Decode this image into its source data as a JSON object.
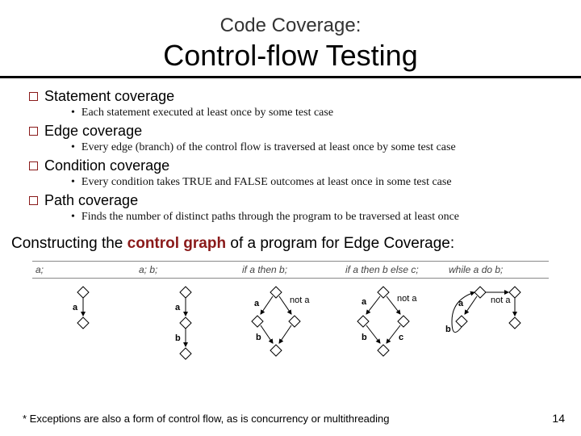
{
  "header": {
    "supertitle": "Code Coverage:",
    "title": "Control-flow Testing"
  },
  "items": [
    {
      "label": "Statement coverage",
      "sub": "Each statement executed at least once by some test case"
    },
    {
      "label": "Edge coverage",
      "sub": "Every edge (branch) of the control flow is traversed at least once by some test case"
    },
    {
      "label": "Condition coverage",
      "sub": "Every condition takes TRUE and FALSE outcomes at least once in some test case"
    },
    {
      "label": "Path coverage",
      "sub": "Finds the number of distinct paths through the program to be traversed at least once"
    }
  ],
  "construct": {
    "prefix": "Constructing the ",
    "em": "control graph",
    "suffix": " of a program for Edge Coverage:"
  },
  "diagrams": {
    "headers": [
      "a;",
      "a; b;",
      "if a then b;",
      "if a then b else c;",
      "while a do b;"
    ],
    "labels": {
      "a": "a",
      "b": "b",
      "c": "c",
      "not_a": "not a"
    }
  },
  "footer": {
    "note": "* Exceptions are also a form of control flow, as is concurrency or multithreading",
    "page": "14"
  }
}
